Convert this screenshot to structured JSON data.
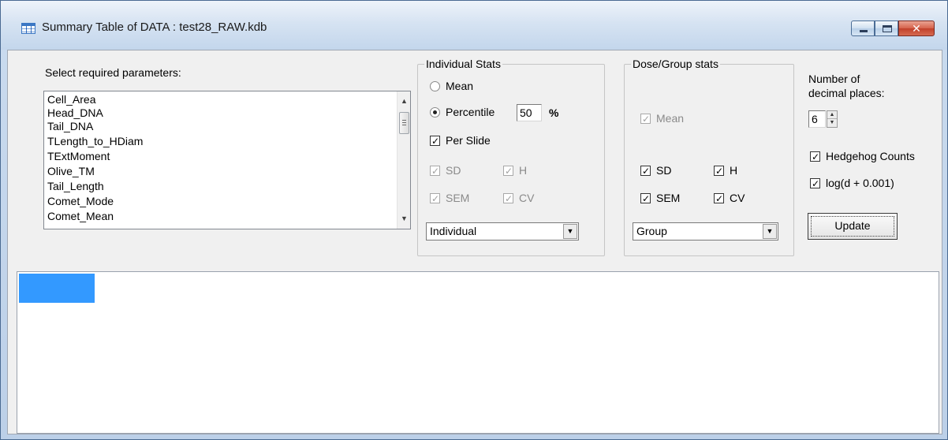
{
  "window": {
    "title": "Summary Table of DATA : test28_RAW.kdb",
    "close_glyph": "✕"
  },
  "parameters": {
    "label": "Select required parameters:",
    "items": [
      "Cell_Area",
      "Head_DNA",
      "Tail_DNA",
      "TLength_to_HDiam",
      "TExtMoment",
      "Olive_TM",
      "Tail_Length",
      "Comet_Mode",
      "Comet_Mean"
    ]
  },
  "individual_stats": {
    "title": "Individual Stats",
    "mean_label": "Mean",
    "percentile_label": "Percentile",
    "percentile_value": "50",
    "percent_symbol": "%",
    "per_slide_label": "Per Slide",
    "sd_label": "SD",
    "h_label": "H",
    "sem_label": "SEM",
    "cv_label": "CV",
    "combo_value": "Individual"
  },
  "group_stats": {
    "title": "Dose/Group stats",
    "mean_label": "Mean",
    "sd_label": "SD",
    "h_label": "H",
    "sem_label": "SEM",
    "cv_label": "CV",
    "combo_value": "Group"
  },
  "options": {
    "decimal_label_line1": "Number of",
    "decimal_label_line2": "decimal places:",
    "decimal_value": "6",
    "hedgehog_label": "Hedgehog Counts",
    "log_label": "log(d + 0.001)",
    "update_label": "Update"
  },
  "glyphs": {
    "check": "✓",
    "up": "▲",
    "down": "▼"
  },
  "colors": {
    "selection": "#3399ff",
    "close_button": "#c94b33"
  }
}
